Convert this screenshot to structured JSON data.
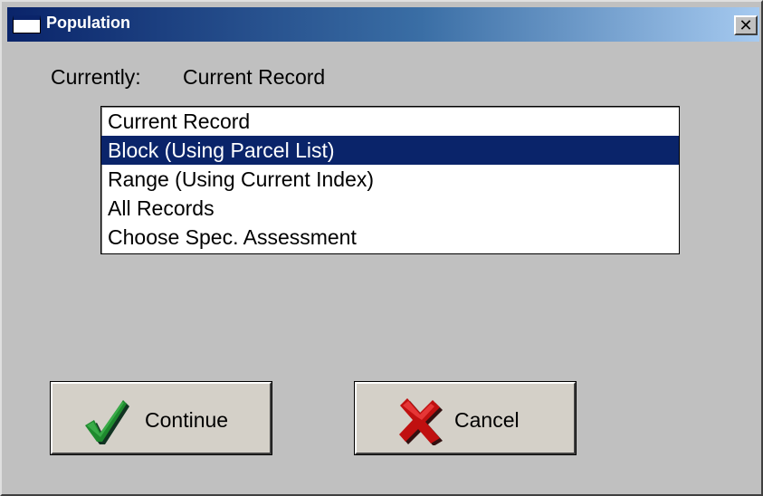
{
  "window": {
    "title": "Population",
    "close_glyph": "✕"
  },
  "currently": {
    "label": "Currently:",
    "value": "Current Record"
  },
  "list": {
    "items": [
      "Current Record",
      "Block (Using Parcel List)",
      "Range (Using Current Index)",
      "All Records",
      "Choose Spec. Assessment"
    ],
    "selected_index": 1
  },
  "buttons": {
    "continue_label": "Continue",
    "continue_icon": "checkmark-icon",
    "cancel_label": "Cancel",
    "cancel_icon": "red-x-icon"
  },
  "colors": {
    "title_bar_start": "#0a246a",
    "title_bar_end": "#a6caf0",
    "selection": "#0a246a",
    "face": "#c0c0c0",
    "check": "#1e8a2e",
    "cross": "#c01010"
  }
}
